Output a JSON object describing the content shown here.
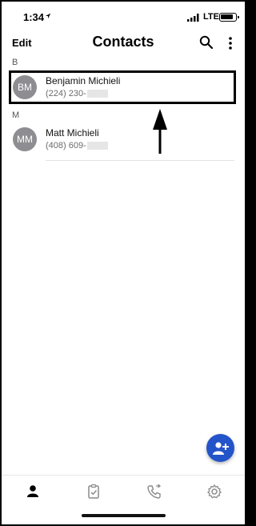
{
  "status": {
    "time": "1:34",
    "network": "LTE"
  },
  "header": {
    "edit_label": "Edit",
    "title": "Contacts"
  },
  "sections": [
    {
      "letter": "B",
      "contacts": [
        {
          "initials": "BM",
          "name": "Benjamin Michieli",
          "phone": "(224) 230-"
        }
      ]
    },
    {
      "letter": "M",
      "contacts": [
        {
          "initials": "MM",
          "name": "Matt Michieli",
          "phone": "(408) 609-"
        }
      ]
    }
  ],
  "icons": {
    "search": "search-icon",
    "more": "more-vertical-icon",
    "add_contact": "add-contact-icon",
    "tabs": [
      "contacts-icon",
      "tasks-icon",
      "calls-icon",
      "settings-icon"
    ]
  },
  "colors": {
    "accent": "#2454c9",
    "avatar": "#8d8d92",
    "selected_tab": "#000000",
    "tab_inactive": "#8a8a8a"
  }
}
